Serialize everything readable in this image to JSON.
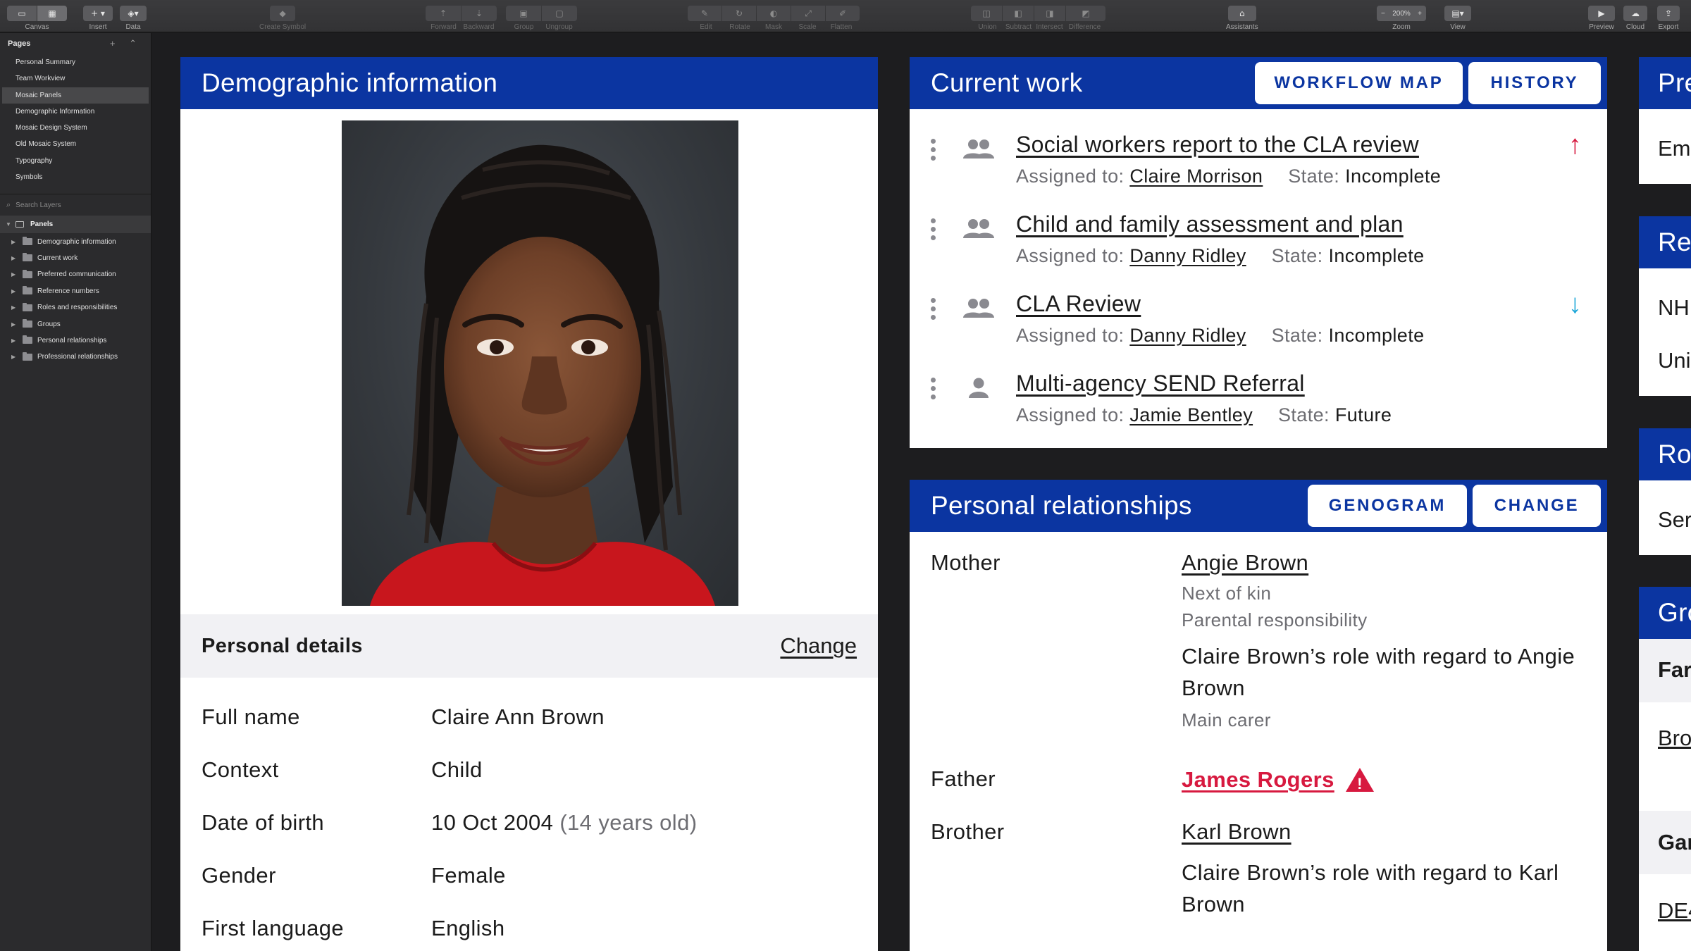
{
  "toolbar": {
    "canvas_label": "Canvas",
    "insert_label": "Insert",
    "insert_icon": "+",
    "data_label": "Data",
    "create_symbol_label": "Create Symbol",
    "forward_label": "Forward",
    "backward_label": "Backward",
    "group_label": "Group",
    "ungroup_label": "Ungroup",
    "edit_label": "Edit",
    "rotate_label": "Rotate",
    "mask_label": "Mask",
    "scale_label": "Scale",
    "flatten_label": "Flatten",
    "union_label": "Union",
    "subtract_label": "Subtract",
    "intersect_label": "Intersect",
    "difference_label": "Difference",
    "assistants_label": "Assistants",
    "zoom_label": "Zoom",
    "zoom_value": "200%",
    "zoom_minus": "−",
    "zoom_plus": "+",
    "view_label": "View",
    "preview_label": "Preview",
    "cloud_label": "Cloud",
    "export_label": "Export"
  },
  "sidebar": {
    "pages_title": "Pages",
    "pages_actions": "+ ⌃",
    "pages": [
      {
        "label": "Personal Summary"
      },
      {
        "label": "Team Workview"
      },
      {
        "label": "Mosaic Panels"
      },
      {
        "label": "Demographic Information"
      },
      {
        "label": "Mosaic Design System"
      },
      {
        "label": "Old Mosaic System"
      },
      {
        "label": "Typography"
      },
      {
        "label": "Symbols"
      }
    ],
    "selected_page": "Mosaic Panels",
    "search_placeholder": "Search Layers",
    "layer_root": "Panels",
    "layers": [
      {
        "label": "Demographic information"
      },
      {
        "label": "Current work"
      },
      {
        "label": "Preferred communication"
      },
      {
        "label": "Reference numbers"
      },
      {
        "label": "Roles and responsibilities"
      },
      {
        "label": "Groups"
      },
      {
        "label": "Personal relationships"
      },
      {
        "label": "Professional relationships"
      }
    ]
  },
  "demographic": {
    "title": "Demographic information",
    "personal_details_title": "Personal details",
    "change_label": "Change",
    "rows": [
      {
        "label": "Full name",
        "value": "Claire Ann Brown",
        "note": ""
      },
      {
        "label": "Context",
        "value": "Child",
        "note": ""
      },
      {
        "label": "Date of birth",
        "value": "10 Oct 2004",
        "note": "(14 years old)"
      },
      {
        "label": "Gender",
        "value": "Female",
        "note": ""
      },
      {
        "label": "First language",
        "value": "English",
        "note": ""
      }
    ]
  },
  "current_work": {
    "title": "Current work",
    "btn_workflow": "WORKFLOW MAP",
    "btn_history": "HISTORY",
    "assigned_label": "Assigned to:",
    "state_label": "State:",
    "tasks": [
      {
        "title": "Social workers report to the CLA review",
        "assignee": "Claire Morrison",
        "state": "Incomplete",
        "icon": "people-icon",
        "arrow": "↑"
      },
      {
        "title": "Child and family assessment and plan",
        "assignee": "Danny Ridley",
        "state": "Incomplete",
        "icon": "people-icon",
        "arrow": ""
      },
      {
        "title": "CLA Review",
        "assignee": "Danny Ridley",
        "state": "Incomplete",
        "icon": "people-icon",
        "arrow": "↓"
      },
      {
        "title": "Multi-agency SEND Referral",
        "assignee": "Jamie Bentley",
        "state": "Future",
        "icon": "person-icon",
        "arrow": ""
      }
    ],
    "colors": {
      "up": "#d7193f",
      "down": "#1ea7d8"
    }
  },
  "relationships": {
    "title": "Personal relationships",
    "btn_genogram": "GENOGRAM",
    "btn_change": "CHANGE",
    "mother_label": "Mother",
    "mother_name": "Angie Brown",
    "mother_sub1": "Next of kin",
    "mother_sub2": "Parental responsibility",
    "mother_role_text": "Claire Brown’s role with regard to Angie Brown",
    "mother_role_value": "Main carer",
    "father_label": "Father",
    "father_name": "James Rogers",
    "warning_icon": "!",
    "brother_label": "Brother",
    "brother_name": "Karl Brown",
    "brother_role_text": "Claire Brown’s role with regard to Karl Brown"
  },
  "right_panels": {
    "p1_title": "Pre",
    "p1_text": "Em",
    "p2_title": "Re",
    "p2_text1": "NH",
    "p2_text2": "Uni",
    "p3_title": "Ro",
    "p3_text": "Ser",
    "p4_title": "Gro",
    "p4_text1": "Far",
    "p4_text2": "Bro",
    "p4_text3": "Gar",
    "p4_text4": "DE4"
  },
  "colors": {
    "brand": "#0b35a1",
    "danger": "#d7193f",
    "info": "#1ea7d8"
  }
}
